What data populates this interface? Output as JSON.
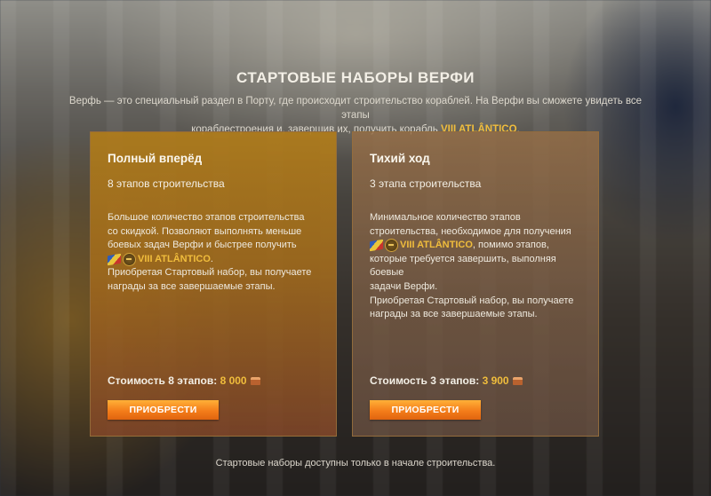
{
  "page": {
    "title": "СТАРТОВЫЕ НАБОРЫ ВЕРФИ",
    "intro_line1": "Верфь — это специальный раздел в Порту, где происходит строительство кораблей. На Верфи вы сможете увидеть все этапы",
    "intro_line2_prefix": "кораблестроения и, завершив их, получить корабль ",
    "intro_ship": "VIII ATLÂNTICO",
    "intro_suffix": ".",
    "footer": "Стартовые наборы доступны только в начале строительства."
  },
  "cards": [
    {
      "name": "Полный вперёд",
      "stages": "8 этапов строительства",
      "desc_line1": "Большое количество этапов строительства",
      "desc_line2": "со скидкой. Позволяют выполнять меньше",
      "desc_line3": "боевых задач Верфи и быстрее получить",
      "ship": "VIII ATLÂNTICO",
      "ship_suffix": ".",
      "desc_line5": "Приобретая Стартовый набор, вы получаете",
      "desc_line6": "награды за все завершаемые этапы.",
      "price_label": "Стоимость 8 этапов: ",
      "price_value": "8 000",
      "button": "ПРИОБРЕСТИ"
    },
    {
      "name": "Тихий ход",
      "stages": "3 этапа строительства",
      "desc_line1": "Минимальное количество этапов",
      "desc_line2": "строительства, необходимое для получения",
      "ship": "VIII ATLÂNTICO",
      "ship_suffix": ", помимо этапов,",
      "desc_line4": "которые требуется завершить, выполняя боевые",
      "desc_line5": "задачи Верфи.",
      "desc_line6": "Приобретая Стартовый набор, вы получаете",
      "desc_line7": "награды за все завершаемые этапы.",
      "price_label": "Стоимость 3 этапов: ",
      "price_value": "3 900",
      "button": "ПРИОБРЕСТИ"
    }
  ],
  "colors": {
    "accent_gold": "#f0bd3c",
    "button_orange": "#f47d1a"
  },
  "icons": {
    "flag": "brazil-flag-icon",
    "tier": "battleship-tier-icon",
    "currency": "doubloon-icon"
  }
}
